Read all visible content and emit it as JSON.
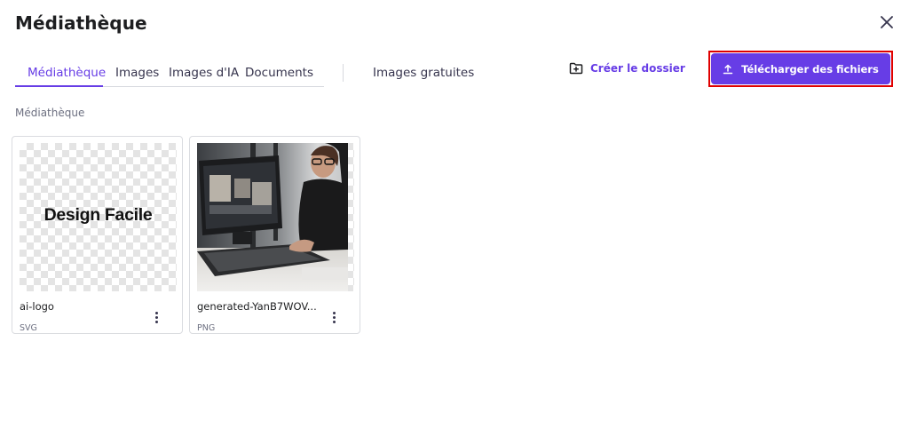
{
  "dialog": {
    "title": "Médiathèque"
  },
  "tabs": [
    {
      "label": "Médiathèque",
      "active": true
    },
    {
      "label": "Images",
      "active": false
    },
    {
      "label": "Images d'IA",
      "active": false
    },
    {
      "label": "Documents",
      "active": false
    }
  ],
  "free_images_tab": "Images gratuites",
  "actions": {
    "create_folder": "Créer le dossier",
    "upload_files": "Télécharger des fichiers"
  },
  "section": {
    "label": "Médiathèque"
  },
  "files": [
    {
      "name": "ai-logo",
      "type": "SVG",
      "preview_text": "Design Facile"
    },
    {
      "name": "generated-YanB7WOV...",
      "type": "PNG"
    }
  ],
  "icons": {
    "close": "close-icon",
    "folder_add": "folder-add-icon",
    "upload": "upload-icon",
    "more": "more-vertical-icon"
  },
  "colors": {
    "accent": "#673de6",
    "highlight_outline": "#e00000",
    "text_primary": "#1d1e20",
    "text_secondary": "#6d7081"
  }
}
